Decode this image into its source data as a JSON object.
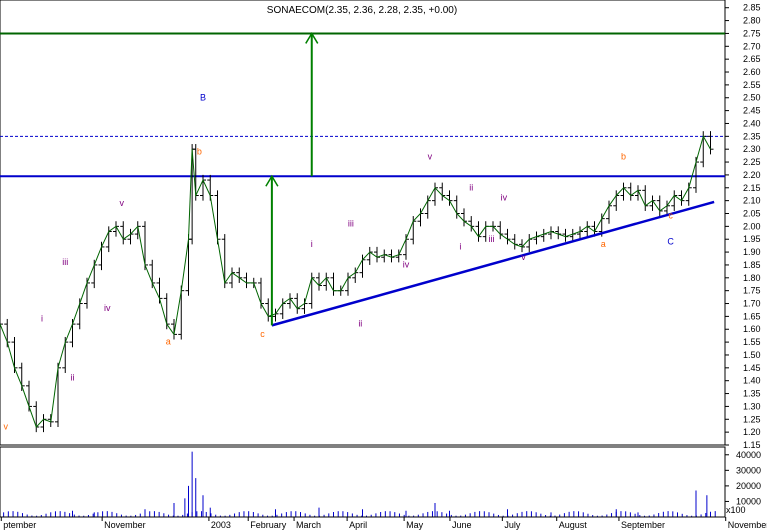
{
  "chart_data": {
    "type": "candlestick",
    "title": "SONAECOM(2.35, 2.36, 2.28, 2.35, +0.00)",
    "price_axis": {
      "range": [
        1.15,
        2.88
      ],
      "ticks": [
        "1.15",
        "1.20",
        "1.25",
        "1.30",
        "1.35",
        "1.40",
        "1.45",
        "1.50",
        "1.55",
        "1.60",
        "1.65",
        "1.70",
        "1.75",
        "1.80",
        "1.85",
        "1.90",
        "1.95",
        "2.00",
        "2.05",
        "2.10",
        "2.15",
        "2.20",
        "2.25",
        "2.30",
        "2.35",
        "2.40",
        "2.45",
        "2.50",
        "2.55",
        "2.60",
        "2.65",
        "2.70",
        "2.75",
        "2.80",
        "2.85"
      ]
    },
    "volume_axis": {
      "range": [
        0,
        45000
      ],
      "ticks": [
        "10000",
        "20000",
        "30000",
        "40000"
      ],
      "unit_label": "x100"
    },
    "x_axis": {
      "labels": [
        "ptember",
        "November",
        "2003",
        "February",
        "March",
        "April",
        "May",
        "June",
        "July",
        "August",
        "September",
        "November"
      ],
      "label_positions": [
        0.005,
        0.159,
        0.322,
        0.382,
        0.452,
        0.533,
        0.62,
        0.69,
        0.77,
        0.853,
        0.948,
        1.111
      ]
    },
    "price_series": [
      {
        "t": 0.0,
        "p": 1.62
      },
      {
        "t": 0.01,
        "p": 1.55
      },
      {
        "t": 0.02,
        "p": 1.45
      },
      {
        "t": 0.03,
        "p": 1.38
      },
      {
        "t": 0.04,
        "p": 1.3
      },
      {
        "t": 0.05,
        "p": 1.22
      },
      {
        "t": 0.06,
        "p": 1.25
      },
      {
        "t": 0.07,
        "p": 1.24
      },
      {
        "t": 0.08,
        "p": 1.45
      },
      {
        "t": 0.09,
        "p": 1.55
      },
      {
        "t": 0.1,
        "p": 1.62
      },
      {
        "t": 0.11,
        "p": 1.7
      },
      {
        "t": 0.12,
        "p": 1.78
      },
      {
        "t": 0.13,
        "p": 1.85
      },
      {
        "t": 0.14,
        "p": 1.92
      },
      {
        "t": 0.15,
        "p": 1.98
      },
      {
        "t": 0.16,
        "p": 2.0
      },
      {
        "t": 0.17,
        "p": 1.95
      },
      {
        "t": 0.18,
        "p": 1.97
      },
      {
        "t": 0.19,
        "p": 2.0
      },
      {
        "t": 0.2,
        "p": 1.85
      },
      {
        "t": 0.21,
        "p": 1.78
      },
      {
        "t": 0.22,
        "p": 1.72
      },
      {
        "t": 0.23,
        "p": 1.62
      },
      {
        "t": 0.24,
        "p": 1.58
      },
      {
        "t": 0.25,
        "p": 1.75
      },
      {
        "t": 0.26,
        "p": 1.95
      },
      {
        "t": 0.265,
        "p": 2.3
      },
      {
        "t": 0.27,
        "p": 2.12
      },
      {
        "t": 0.28,
        "p": 2.18
      },
      {
        "t": 0.29,
        "p": 2.12
      },
      {
        "t": 0.3,
        "p": 1.95
      },
      {
        "t": 0.31,
        "p": 1.78
      },
      {
        "t": 0.32,
        "p": 1.82
      },
      {
        "t": 0.33,
        "p": 1.8
      },
      {
        "t": 0.34,
        "p": 1.78
      },
      {
        "t": 0.35,
        "p": 1.78
      },
      {
        "t": 0.36,
        "p": 1.7
      },
      {
        "t": 0.37,
        "p": 1.65
      },
      {
        "t": 0.38,
        "p": 1.66
      },
      {
        "t": 0.39,
        "p": 1.7
      },
      {
        "t": 0.4,
        "p": 1.72
      },
      {
        "t": 0.41,
        "p": 1.68
      },
      {
        "t": 0.42,
        "p": 1.7
      },
      {
        "t": 0.43,
        "p": 1.8
      },
      {
        "t": 0.44,
        "p": 1.77
      },
      {
        "t": 0.45,
        "p": 1.8
      },
      {
        "t": 0.46,
        "p": 1.75
      },
      {
        "t": 0.47,
        "p": 1.75
      },
      {
        "t": 0.48,
        "p": 1.8
      },
      {
        "t": 0.49,
        "p": 1.82
      },
      {
        "t": 0.5,
        "p": 1.87
      },
      {
        "t": 0.51,
        "p": 1.9
      },
      {
        "t": 0.52,
        "p": 1.88
      },
      {
        "t": 0.53,
        "p": 1.89
      },
      {
        "t": 0.54,
        "p": 1.88
      },
      {
        "t": 0.55,
        "p": 1.89
      },
      {
        "t": 0.56,
        "p": 1.95
      },
      {
        "t": 0.57,
        "p": 2.02
      },
      {
        "t": 0.58,
        "p": 2.05
      },
      {
        "t": 0.59,
        "p": 2.1
      },
      {
        "t": 0.6,
        "p": 2.15
      },
      {
        "t": 0.61,
        "p": 2.12
      },
      {
        "t": 0.62,
        "p": 2.1
      },
      {
        "t": 0.63,
        "p": 2.05
      },
      {
        "t": 0.64,
        "p": 2.02
      },
      {
        "t": 0.65,
        "p": 2.0
      },
      {
        "t": 0.66,
        "p": 1.96
      },
      {
        "t": 0.67,
        "p": 2.0
      },
      {
        "t": 0.68,
        "p": 2.0
      },
      {
        "t": 0.69,
        "p": 1.97
      },
      {
        "t": 0.7,
        "p": 1.95
      },
      {
        "t": 0.71,
        "p": 1.93
      },
      {
        "t": 0.72,
        "p": 1.92
      },
      {
        "t": 0.73,
        "p": 1.95
      },
      {
        "t": 0.74,
        "p": 1.96
      },
      {
        "t": 0.75,
        "p": 1.97
      },
      {
        "t": 0.76,
        "p": 1.98
      },
      {
        "t": 0.77,
        "p": 1.97
      },
      {
        "t": 0.78,
        "p": 1.96
      },
      {
        "t": 0.79,
        "p": 1.97
      },
      {
        "t": 0.8,
        "p": 1.98
      },
      {
        "t": 0.81,
        "p": 2.0
      },
      {
        "t": 0.82,
        "p": 1.98
      },
      {
        "t": 0.83,
        "p": 2.03
      },
      {
        "t": 0.84,
        "p": 2.08
      },
      {
        "t": 0.85,
        "p": 2.12
      },
      {
        "t": 0.86,
        "p": 2.15
      },
      {
        "t": 0.87,
        "p": 2.12
      },
      {
        "t": 0.88,
        "p": 2.14
      },
      {
        "t": 0.89,
        "p": 2.08
      },
      {
        "t": 0.9,
        "p": 2.1
      },
      {
        "t": 0.91,
        "p": 2.06
      },
      {
        "t": 0.92,
        "p": 2.08
      },
      {
        "t": 0.93,
        "p": 2.12
      },
      {
        "t": 0.94,
        "p": 2.1
      },
      {
        "t": 0.95,
        "p": 2.15
      },
      {
        "t": 0.96,
        "p": 2.25
      },
      {
        "t": 0.97,
        "p": 2.35
      },
      {
        "t": 0.98,
        "p": 2.3
      }
    ],
    "volume_series": [
      {
        "t": 0.1,
        "v": 4000
      },
      {
        "t": 0.13,
        "v": 3000
      },
      {
        "t": 0.2,
        "v": 5000
      },
      {
        "t": 0.24,
        "v": 9000
      },
      {
        "t": 0.255,
        "v": 12000
      },
      {
        "t": 0.26,
        "v": 20000
      },
      {
        "t": 0.265,
        "v": 42000
      },
      {
        "t": 0.27,
        "v": 25000
      },
      {
        "t": 0.28,
        "v": 14000
      },
      {
        "t": 0.29,
        "v": 6000
      },
      {
        "t": 0.38,
        "v": 5000
      },
      {
        "t": 0.44,
        "v": 6000
      },
      {
        "t": 0.5,
        "v": 5000
      },
      {
        "t": 0.56,
        "v": 4000
      },
      {
        "t": 0.6,
        "v": 9000
      },
      {
        "t": 0.62,
        "v": 4000
      },
      {
        "t": 0.7,
        "v": 5000
      },
      {
        "t": 0.76,
        "v": 3000
      },
      {
        "t": 0.85,
        "v": 5000
      },
      {
        "t": 0.88,
        "v": 3000
      },
      {
        "t": 0.96,
        "v": 17000
      },
      {
        "t": 0.975,
        "v": 14000
      }
    ],
    "horizontal_lines": [
      {
        "name": "target-level",
        "value": 2.75,
        "color": "#006400",
        "style": "solid"
      },
      {
        "name": "last-price",
        "value": 2.35,
        "color": "#0000cc",
        "style": "dashed"
      },
      {
        "name": "resistance",
        "value": 2.195,
        "color": "#0000cc",
        "style": "solid"
      }
    ],
    "trend_line": {
      "from": {
        "t": 0.375,
        "p": 1.615
      },
      "to": {
        "t": 0.985,
        "p": 2.095
      },
      "color": "#0000cc"
    },
    "arrows": [
      {
        "t": 0.375,
        "from": 1.615,
        "to": 2.195,
        "color": "#008000"
      },
      {
        "t": 0.43,
        "from": 2.195,
        "to": 2.75,
        "color": "#008000"
      }
    ],
    "wave_labels": [
      {
        "text": "v",
        "t": 0.008,
        "p": 1.21,
        "color": "#ff6600"
      },
      {
        "text": "i",
        "t": 0.058,
        "p": 1.63,
        "color": "#800080"
      },
      {
        "text": "ii",
        "t": 0.1,
        "p": 1.4,
        "color": "#800080"
      },
      {
        "text": "iii",
        "t": 0.09,
        "p": 1.85,
        "color": "#800080"
      },
      {
        "text": "iv",
        "t": 0.148,
        "p": 1.67,
        "color": "#800080"
      },
      {
        "text": "v",
        "t": 0.168,
        "p": 2.08,
        "color": "#800080"
      },
      {
        "text": "a",
        "t": 0.232,
        "p": 1.54,
        "color": "#ff6600"
      },
      {
        "text": "B",
        "t": 0.28,
        "p": 2.49,
        "color": "#0000cc"
      },
      {
        "text": "b",
        "t": 0.275,
        "p": 2.28,
        "color": "#ff6600"
      },
      {
        "text": "c",
        "t": 0.362,
        "p": 1.57,
        "color": "#ff6600"
      },
      {
        "text": "i",
        "t": 0.43,
        "p": 1.92,
        "color": "#800080"
      },
      {
        "text": "ii",
        "t": 0.497,
        "p": 1.61,
        "color": "#800080"
      },
      {
        "text": "iii",
        "t": 0.484,
        "p": 2.0,
        "color": "#800080"
      },
      {
        "text": "iv",
        "t": 0.56,
        "p": 1.84,
        "color": "#800080"
      },
      {
        "text": "v",
        "t": 0.593,
        "p": 2.26,
        "color": "#800080"
      },
      {
        "text": "i",
        "t": 0.635,
        "p": 1.91,
        "color": "#800080"
      },
      {
        "text": "ii",
        "t": 0.65,
        "p": 2.14,
        "color": "#800080"
      },
      {
        "text": "iii",
        "t": 0.678,
        "p": 1.94,
        "color": "#800080"
      },
      {
        "text": "iv",
        "t": 0.695,
        "p": 2.1,
        "color": "#800080"
      },
      {
        "text": "v",
        "t": 0.722,
        "p": 1.87,
        "color": "#800080"
      },
      {
        "text": "a",
        "t": 0.832,
        "p": 1.92,
        "color": "#ff6600"
      },
      {
        "text": "b",
        "t": 0.86,
        "p": 2.26,
        "color": "#ff6600"
      },
      {
        "text": "c",
        "t": 0.925,
        "p": 2.03,
        "color": "#ff6600"
      },
      {
        "text": "C",
        "t": 0.925,
        "p": 1.93,
        "color": "#0000cc"
      }
    ],
    "grid": false
  }
}
